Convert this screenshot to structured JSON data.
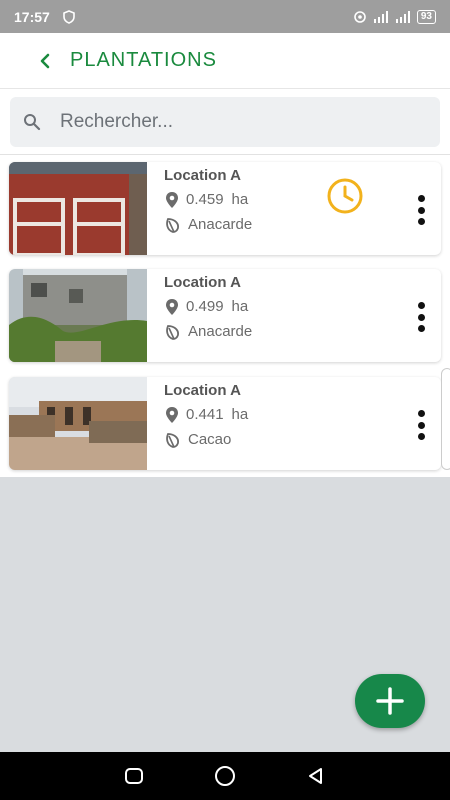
{
  "status_bar": {
    "time": "17:57",
    "battery": "93"
  },
  "header": {
    "title": "PLANTATIONS"
  },
  "search": {
    "placeholder": "Rechercher..."
  },
  "plantations": [
    {
      "name": "Location A",
      "area": "0.459",
      "unit": "ha",
      "crop": "Anacarde",
      "pending": true
    },
    {
      "name": "Location A",
      "area": "0.499",
      "unit": "ha",
      "crop": "Anacarde",
      "pending": false
    },
    {
      "name": "Location A",
      "area": "0.441",
      "unit": "ha",
      "crop": "Cacao",
      "pending": false
    }
  ],
  "colors": {
    "brand_green": "#1a8a3e",
    "fab_green": "#17884a",
    "pending_amber": "#f2b21c"
  },
  "icons": {
    "back": "chevron-left-icon",
    "search": "search-icon",
    "location": "location-pin-icon",
    "crop": "leaf-icon",
    "pending": "clock-icon",
    "menu": "more-vert-icon",
    "add": "plus-icon"
  }
}
